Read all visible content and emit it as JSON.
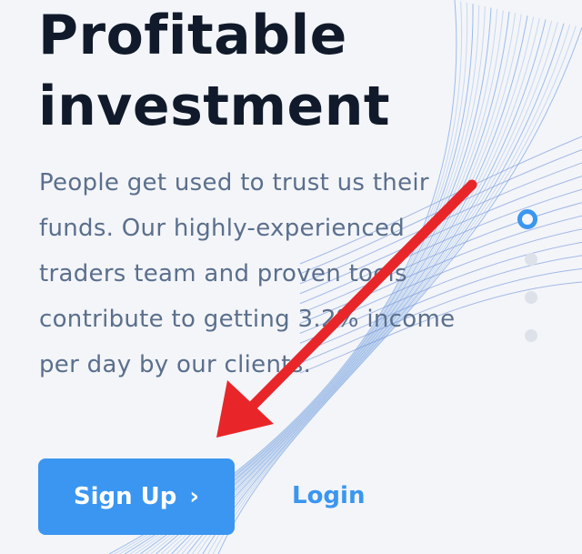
{
  "hero": {
    "title_line1": "Profitable",
    "title_line2": "investment",
    "description": "People get used to trust us their funds. Our highly-experienced traders team and proven tools contribute to getting 3.2% income per day by our clients."
  },
  "actions": {
    "signup_label": "Sign Up",
    "signup_icon": "chevron-right-icon",
    "login_label": "Login"
  },
  "slider": {
    "active_index": 0,
    "count": 4
  },
  "colors": {
    "background": "#f3f5f9",
    "title": "#101a2a",
    "body_text": "#5b6f8c",
    "accent": "#3a96f0",
    "annotation_arrow": "#e8262a"
  }
}
